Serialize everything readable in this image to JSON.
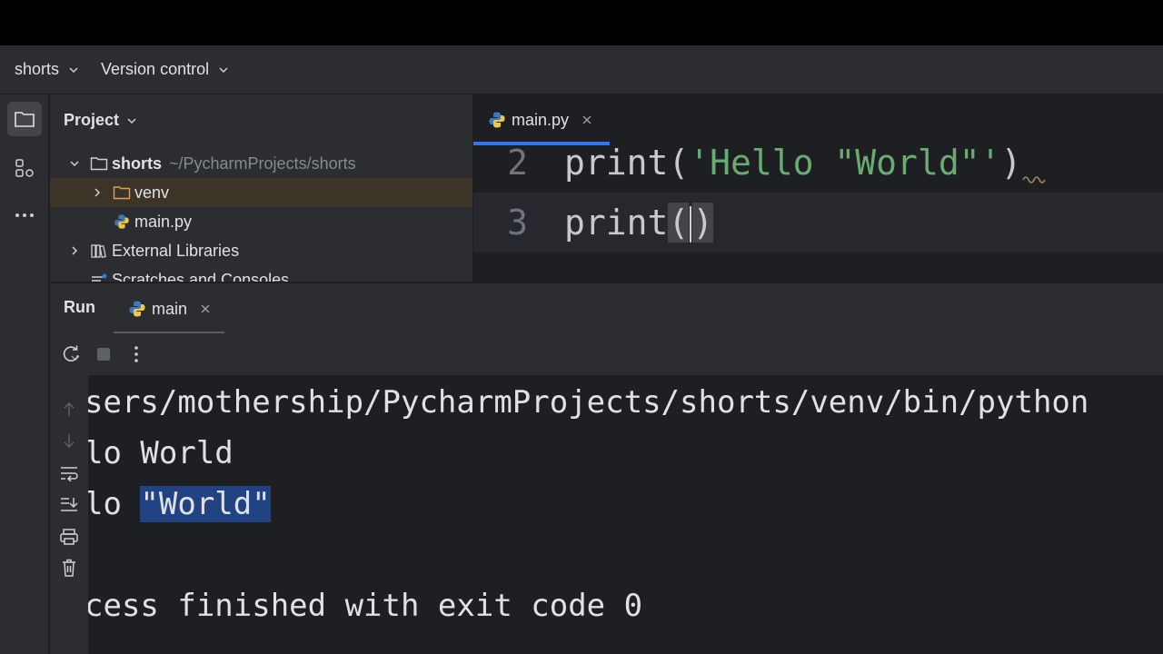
{
  "toolbar": {
    "project_name": "shorts",
    "vcs_label": "Version control"
  },
  "project_panel": {
    "title": "Project",
    "tree": [
      {
        "label": "shorts",
        "hint": "~/PycharmProjects/shorts"
      },
      {
        "label": "venv"
      },
      {
        "label": "main.py"
      },
      {
        "label": "External Libraries"
      },
      {
        "label": "Scratches and Consoles"
      }
    ]
  },
  "editor": {
    "tab_label": "main.py",
    "lines": [
      {
        "number": "2",
        "func": "print",
        "open": "(",
        "string": "'Hello \"World\"'",
        "close": ")"
      },
      {
        "number": "3",
        "func": "print",
        "open": "(",
        "close": ")"
      }
    ]
  },
  "run_panel": {
    "title": "Run",
    "tab_label": "main",
    "console": {
      "line1": "sers/mothership/PycharmProjects/shorts/venv/bin/python",
      "line2": "lo World",
      "line3_prefix": "lo ",
      "line3_selected": "\"World\"",
      "line4": "cess finished with exit code 0"
    }
  },
  "colors": {
    "accent": "#3574f0",
    "string": "#6aab73",
    "selection": "#214283",
    "selected_row": "#3d3428"
  }
}
